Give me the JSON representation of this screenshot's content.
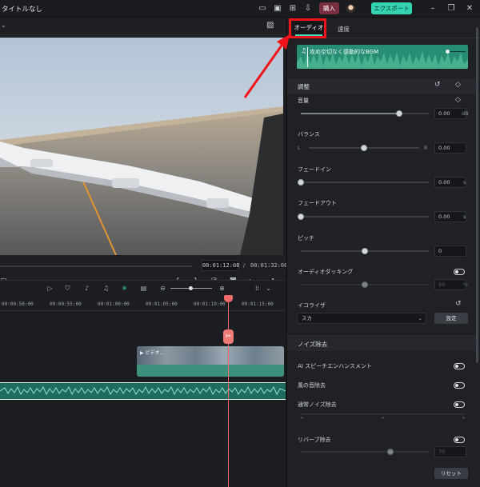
{
  "app": {
    "title": "タイトルなし",
    "buy_label": "購入",
    "export_label": "エクスポート"
  },
  "preview": {
    "current_time": "00:01:12:08",
    "separator": "/",
    "total_time": "00:01:32:08"
  },
  "timeline": {
    "ruler": [
      "00:00:50:00",
      "00:00:55:00",
      "00:01:00:00",
      "00:01:05:00",
      "00:01:10:00",
      "00:01:15:00"
    ],
    "clip_label": "ビデオ..."
  },
  "right_panel": {
    "tabs": [
      {
        "label": "オーディオ",
        "active": true
      },
      {
        "label": "速度",
        "active": false
      }
    ],
    "music_name": "攻め空切なく感動的なBGM",
    "adjust_title": "調整",
    "volume": {
      "label": "音量",
      "value": "0.00",
      "unit": "dB",
      "level": 0.77
    },
    "balance": {
      "label": "バランス",
      "left": "L",
      "right": "R",
      "value": "0.00",
      "level": 0.5
    },
    "fade_in": {
      "label": "フェードイン",
      "value": "0.00",
      "unit": "s",
      "level": 0.0
    },
    "fade_out": {
      "label": "フェードアウト",
      "value": "0.00",
      "unit": "s",
      "level": 0.0
    },
    "pitch": {
      "label": "ピッチ",
      "value": "0",
      "level": 0.5
    },
    "ducking": {
      "label": "オーディオダッキング",
      "value": "50",
      "unit": "%",
      "level": 0.5
    },
    "equalizer": {
      "label": "イコライザ",
      "preset": "スカ",
      "setting_label": "設定"
    },
    "noise_title": "ノイズ除去",
    "ai_speech": {
      "label": "AI スピーチエンハンスメント"
    },
    "wind": {
      "label": "風の音除去"
    },
    "normal_noise": {
      "label": "通常ノイズ除去"
    },
    "reverb": {
      "label": "リバーブ除去",
      "value": "70",
      "level": 0.7
    },
    "reset_label": "リセット"
  },
  "colors": {
    "accent": "#35d4b0",
    "highlight": "#f0141a",
    "playhead": "#f06a6a",
    "audio_track": "#278d74"
  }
}
